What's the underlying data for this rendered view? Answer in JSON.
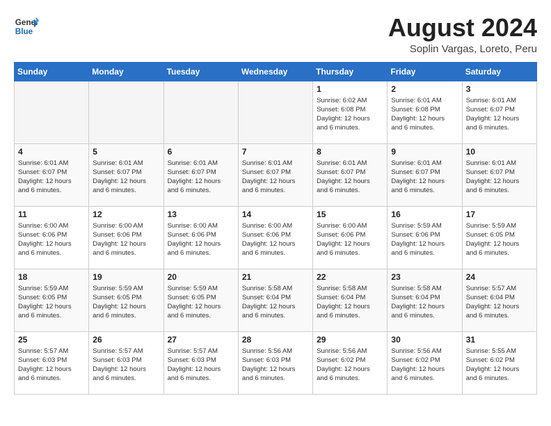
{
  "header": {
    "logo_line1": "General",
    "logo_line2": "Blue",
    "month_year": "August 2024",
    "location": "Soplin Vargas, Loreto, Peru"
  },
  "weekdays": [
    "Sunday",
    "Monday",
    "Tuesday",
    "Wednesday",
    "Thursday",
    "Friday",
    "Saturday"
  ],
  "weeks": [
    [
      {
        "day": "",
        "info": ""
      },
      {
        "day": "",
        "info": ""
      },
      {
        "day": "",
        "info": ""
      },
      {
        "day": "",
        "info": ""
      },
      {
        "day": "1",
        "info": "Sunrise: 6:02 AM\nSunset: 6:08 PM\nDaylight: 12 hours\nand 6 minutes."
      },
      {
        "day": "2",
        "info": "Sunrise: 6:01 AM\nSunset: 6:08 PM\nDaylight: 12 hours\nand 6 minutes."
      },
      {
        "day": "3",
        "info": "Sunrise: 6:01 AM\nSunset: 6:07 PM\nDaylight: 12 hours\nand 6 minutes."
      }
    ],
    [
      {
        "day": "4",
        "info": "Sunrise: 6:01 AM\nSunset: 6:07 PM\nDaylight: 12 hours\nand 6 minutes."
      },
      {
        "day": "5",
        "info": "Sunrise: 6:01 AM\nSunset: 6:07 PM\nDaylight: 12 hours\nand 6 minutes."
      },
      {
        "day": "6",
        "info": "Sunrise: 6:01 AM\nSunset: 6:07 PM\nDaylight: 12 hours\nand 6 minutes."
      },
      {
        "day": "7",
        "info": "Sunrise: 6:01 AM\nSunset: 6:07 PM\nDaylight: 12 hours\nand 6 minutes."
      },
      {
        "day": "8",
        "info": "Sunrise: 6:01 AM\nSunset: 6:07 PM\nDaylight: 12 hours\nand 6 minutes."
      },
      {
        "day": "9",
        "info": "Sunrise: 6:01 AM\nSunset: 6:07 PM\nDaylight: 12 hours\nand 6 minutes."
      },
      {
        "day": "10",
        "info": "Sunrise: 6:01 AM\nSunset: 6:07 PM\nDaylight: 12 hours\nand 6 minutes."
      }
    ],
    [
      {
        "day": "11",
        "info": "Sunrise: 6:00 AM\nSunset: 6:06 PM\nDaylight: 12 hours\nand 6 minutes."
      },
      {
        "day": "12",
        "info": "Sunrise: 6:00 AM\nSunset: 6:06 PM\nDaylight: 12 hours\nand 6 minutes."
      },
      {
        "day": "13",
        "info": "Sunrise: 6:00 AM\nSunset: 6:06 PM\nDaylight: 12 hours\nand 6 minutes."
      },
      {
        "day": "14",
        "info": "Sunrise: 6:00 AM\nSunset: 6:06 PM\nDaylight: 12 hours\nand 6 minutes."
      },
      {
        "day": "15",
        "info": "Sunrise: 6:00 AM\nSunset: 6:06 PM\nDaylight: 12 hours\nand 6 minutes."
      },
      {
        "day": "16",
        "info": "Sunrise: 5:59 AM\nSunset: 6:06 PM\nDaylight: 12 hours\nand 6 minutes."
      },
      {
        "day": "17",
        "info": "Sunrise: 5:59 AM\nSunset: 6:05 PM\nDaylight: 12 hours\nand 6 minutes."
      }
    ],
    [
      {
        "day": "18",
        "info": "Sunrise: 5:59 AM\nSunset: 6:05 PM\nDaylight: 12 hours\nand 6 minutes."
      },
      {
        "day": "19",
        "info": "Sunrise: 5:59 AM\nSunset: 6:05 PM\nDaylight: 12 hours\nand 6 minutes."
      },
      {
        "day": "20",
        "info": "Sunrise: 5:59 AM\nSunset: 6:05 PM\nDaylight: 12 hours\nand 6 minutes."
      },
      {
        "day": "21",
        "info": "Sunrise: 5:58 AM\nSunset: 6:04 PM\nDaylight: 12 hours\nand 6 minutes."
      },
      {
        "day": "22",
        "info": "Sunrise: 5:58 AM\nSunset: 6:04 PM\nDaylight: 12 hours\nand 6 minutes."
      },
      {
        "day": "23",
        "info": "Sunrise: 5:58 AM\nSunset: 6:04 PM\nDaylight: 12 hours\nand 6 minutes."
      },
      {
        "day": "24",
        "info": "Sunrise: 5:57 AM\nSunset: 6:04 PM\nDaylight: 12 hours\nand 6 minutes."
      }
    ],
    [
      {
        "day": "25",
        "info": "Sunrise: 5:57 AM\nSunset: 6:03 PM\nDaylight: 12 hours\nand 6 minutes."
      },
      {
        "day": "26",
        "info": "Sunrise: 5:57 AM\nSunset: 6:03 PM\nDaylight: 12 hours\nand 6 minutes."
      },
      {
        "day": "27",
        "info": "Sunrise: 5:57 AM\nSunset: 6:03 PM\nDaylight: 12 hours\nand 6 minutes."
      },
      {
        "day": "28",
        "info": "Sunrise: 5:56 AM\nSunset: 6:03 PM\nDaylight: 12 hours\nand 6 minutes."
      },
      {
        "day": "29",
        "info": "Sunrise: 5:56 AM\nSunset: 6:02 PM\nDaylight: 12 hours\nand 6 minutes."
      },
      {
        "day": "30",
        "info": "Sunrise: 5:56 AM\nSunset: 6:02 PM\nDaylight: 12 hours\nand 6 minutes."
      },
      {
        "day": "31",
        "info": "Sunrise: 5:55 AM\nSunset: 6:02 PM\nDaylight: 12 hours\nand 6 minutes."
      }
    ]
  ]
}
